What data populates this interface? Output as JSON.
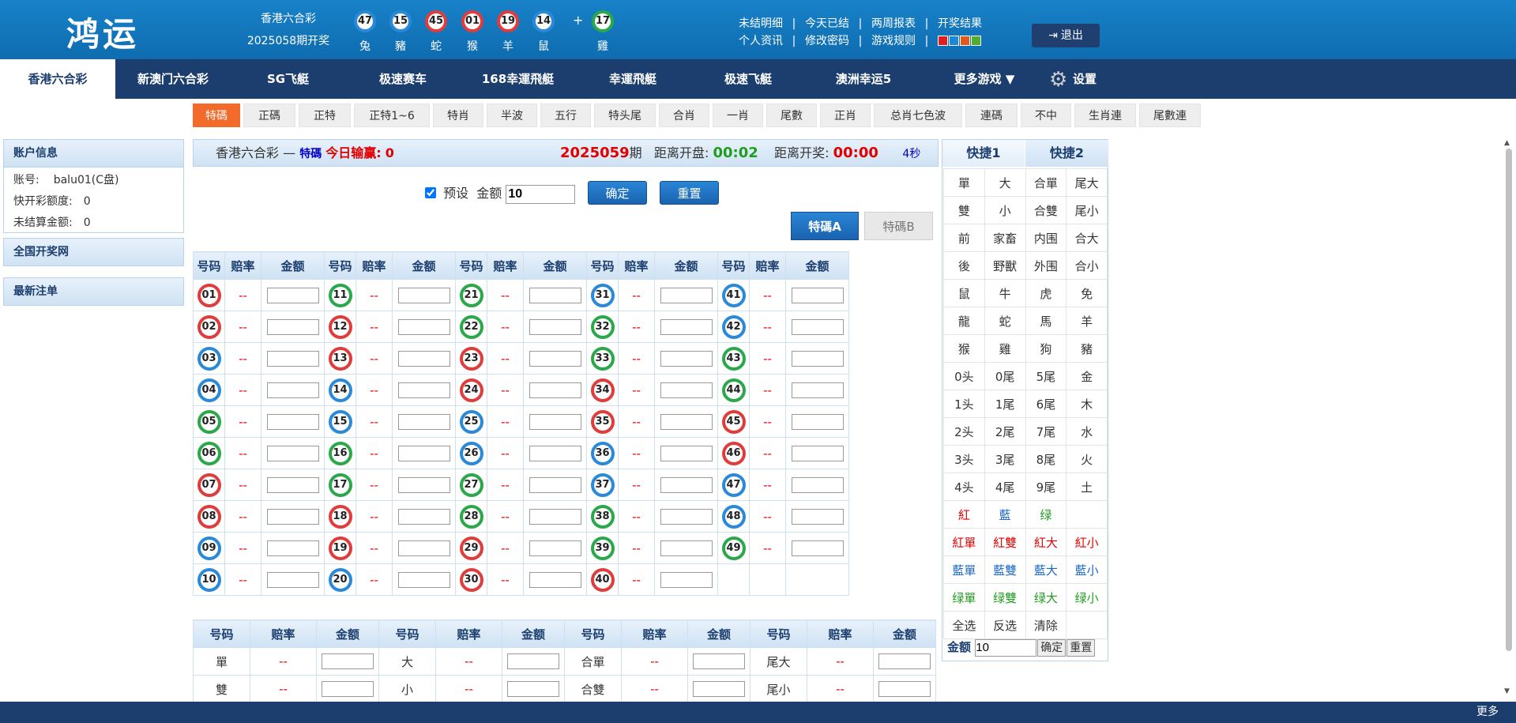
{
  "header": {
    "logo": "鸿运",
    "draw_name": "香港六合彩",
    "draw_issue": "2025058期开奖",
    "balls": [
      {
        "num": "47",
        "zodiac": "兔",
        "color": "blue"
      },
      {
        "num": "15",
        "zodiac": "豬",
        "color": "blue"
      },
      {
        "num": "45",
        "zodiac": "蛇",
        "color": "red"
      },
      {
        "num": "01",
        "zodiac": "猴",
        "color": "red"
      },
      {
        "num": "19",
        "zodiac": "羊",
        "color": "red"
      },
      {
        "num": "14",
        "zodiac": "鼠",
        "color": "blue"
      }
    ],
    "plus": "+",
    "special_ball": {
      "num": "17",
      "zodiac": "雞",
      "color": "green"
    },
    "links_row1": [
      "未结明细",
      "今天已结",
      "两周报表",
      "开奖结果"
    ],
    "links_row2": [
      "个人资讯",
      "修改密码",
      "游戏规则"
    ],
    "separator": "|",
    "swatch_colors": [
      "#e02020",
      "#1a8ad6",
      "#e05a1a",
      "#4fae2a"
    ],
    "logout_label": "退出",
    "logout_icon": "logout-icon"
  },
  "nav": {
    "items": [
      "香港六合彩",
      "新澳门六合彩",
      "SG飞艇",
      "极速赛车",
      "168幸運飛艇",
      "幸運飛艇",
      "极速飞艇",
      "澳洲幸运5",
      "更多游戏 ▼"
    ],
    "active_index": 0,
    "settings_label": "设置",
    "settings_icon": "gear-icon"
  },
  "subtabs": {
    "items": [
      "特碼",
      "正碼",
      "正特",
      "正特1~6",
      "特肖",
      "半波",
      "五行",
      "特头尾",
      "合肖",
      "一肖",
      "尾數",
      "正肖",
      "总肖七色波",
      "連碼",
      "不中",
      "生肖連",
      "尾數連"
    ],
    "active_index": 0
  },
  "sidebar": {
    "account_title": "账户信息",
    "account_rows": [
      {
        "label": "账号:",
        "value": "balu01(C盘)"
      },
      {
        "label": "快开彩额度:",
        "value": "0"
      },
      {
        "label": "未结算金额:",
        "value": "0"
      }
    ],
    "national_title": "全国开奖网",
    "recent_title": "最新注单"
  },
  "bet_header": {
    "game": "香港六合彩",
    "dash": "—",
    "type": "特碼",
    "profit_label": "今日输赢:",
    "profit_value": "0",
    "issue": "2025059",
    "issue_suffix": "期",
    "close_label": "距离开盘:",
    "close_value": "00:02",
    "draw_label": "距离开奖:",
    "draw_value": "00:00",
    "refresh": "4秒"
  },
  "controls": {
    "preset_label": "预设",
    "amount_label": "金额",
    "amount_value": "10",
    "confirm": "确定",
    "reset": "重置",
    "te_a": "特碼A",
    "te_b": "特碼B"
  },
  "num_table": {
    "headers": [
      "号码",
      "赔率",
      "金额"
    ],
    "odds_placeholder": "--",
    "numbers": [
      {
        "n": "01",
        "c": "red"
      },
      {
        "n": "02",
        "c": "red"
      },
      {
        "n": "03",
        "c": "blue"
      },
      {
        "n": "04",
        "c": "blue"
      },
      {
        "n": "05",
        "c": "green"
      },
      {
        "n": "06",
        "c": "green"
      },
      {
        "n": "07",
        "c": "red"
      },
      {
        "n": "08",
        "c": "red"
      },
      {
        "n": "09",
        "c": "blue"
      },
      {
        "n": "10",
        "c": "blue"
      },
      {
        "n": "11",
        "c": "green"
      },
      {
        "n": "12",
        "c": "red"
      },
      {
        "n": "13",
        "c": "red"
      },
      {
        "n": "14",
        "c": "blue"
      },
      {
        "n": "15",
        "c": "blue"
      },
      {
        "n": "16",
        "c": "green"
      },
      {
        "n": "17",
        "c": "green"
      },
      {
        "n": "18",
        "c": "red"
      },
      {
        "n": "19",
        "c": "red"
      },
      {
        "n": "20",
        "c": "blue"
      },
      {
        "n": "21",
        "c": "green"
      },
      {
        "n": "22",
        "c": "green"
      },
      {
        "n": "23",
        "c": "red"
      },
      {
        "n": "24",
        "c": "red"
      },
      {
        "n": "25",
        "c": "blue"
      },
      {
        "n": "26",
        "c": "blue"
      },
      {
        "n": "27",
        "c": "green"
      },
      {
        "n": "28",
        "c": "green"
      },
      {
        "n": "29",
        "c": "red"
      },
      {
        "n": "30",
        "c": "red"
      },
      {
        "n": "31",
        "c": "blue"
      },
      {
        "n": "32",
        "c": "green"
      },
      {
        "n": "33",
        "c": "green"
      },
      {
        "n": "34",
        "c": "red"
      },
      {
        "n": "35",
        "c": "red"
      },
      {
        "n": "36",
        "c": "blue"
      },
      {
        "n": "37",
        "c": "blue"
      },
      {
        "n": "38",
        "c": "green"
      },
      {
        "n": "39",
        "c": "green"
      },
      {
        "n": "40",
        "c": "red"
      },
      {
        "n": "41",
        "c": "blue"
      },
      {
        "n": "42",
        "c": "blue"
      },
      {
        "n": "43",
        "c": "green"
      },
      {
        "n": "44",
        "c": "green"
      },
      {
        "n": "45",
        "c": "red"
      },
      {
        "n": "46",
        "c": "red"
      },
      {
        "n": "47",
        "c": "blue"
      },
      {
        "n": "48",
        "c": "blue"
      },
      {
        "n": "49",
        "c": "green"
      }
    ]
  },
  "prop_table": {
    "headers": [
      "号码",
      "赔率",
      "金额"
    ],
    "rows": [
      [
        "單",
        "大",
        "合單",
        "尾大"
      ],
      [
        "雙",
        "小",
        "合雙",
        "尾小"
      ]
    ]
  },
  "quick": {
    "tabs": [
      "快捷1",
      "快捷2"
    ],
    "active_tab": 0,
    "grid": [
      [
        {
          "t": "單"
        },
        {
          "t": "大"
        },
        {
          "t": "合單"
        },
        {
          "t": "尾大"
        }
      ],
      [
        {
          "t": "雙"
        },
        {
          "t": "小"
        },
        {
          "t": "合雙"
        },
        {
          "t": "尾小"
        }
      ],
      [
        {
          "t": "前"
        },
        {
          "t": "家畜"
        },
        {
          "t": "内围"
        },
        {
          "t": "合大"
        }
      ],
      [
        {
          "t": "後"
        },
        {
          "t": "野獸"
        },
        {
          "t": "外围"
        },
        {
          "t": "合小"
        }
      ],
      [
        {
          "t": "鼠"
        },
        {
          "t": "牛"
        },
        {
          "t": "虎"
        },
        {
          "t": "免"
        }
      ],
      [
        {
          "t": "龍"
        },
        {
          "t": "蛇"
        },
        {
          "t": "馬"
        },
        {
          "t": "羊"
        }
      ],
      [
        {
          "t": "猴"
        },
        {
          "t": "雞"
        },
        {
          "t": "狗"
        },
        {
          "t": "豬"
        }
      ],
      [
        {
          "t": "0头"
        },
        {
          "t": "0尾"
        },
        {
          "t": "5尾"
        },
        {
          "t": "金"
        }
      ],
      [
        {
          "t": "1头"
        },
        {
          "t": "1尾"
        },
        {
          "t": "6尾"
        },
        {
          "t": "木"
        }
      ],
      [
        {
          "t": "2头"
        },
        {
          "t": "2尾"
        },
        {
          "t": "7尾"
        },
        {
          "t": "水"
        }
      ],
      [
        {
          "t": "3头"
        },
        {
          "t": "3尾"
        },
        {
          "t": "8尾"
        },
        {
          "t": "火"
        }
      ],
      [
        {
          "t": "4头"
        },
        {
          "t": "4尾"
        },
        {
          "t": "9尾"
        },
        {
          "t": "土"
        }
      ],
      [
        {
          "t": "紅",
          "c": "red"
        },
        {
          "t": "藍",
          "c": "blue"
        },
        {
          "t": "绿",
          "c": "green"
        },
        {
          "t": ""
        }
      ],
      [
        {
          "t": "紅單",
          "c": "red"
        },
        {
          "t": "紅雙",
          "c": "red"
        },
        {
          "t": "紅大",
          "c": "red"
        },
        {
          "t": "紅小",
          "c": "red"
        }
      ],
      [
        {
          "t": "藍單",
          "c": "blue"
        },
        {
          "t": "藍雙",
          "c": "blue"
        },
        {
          "t": "藍大",
          "c": "blue"
        },
        {
          "t": "藍小",
          "c": "blue"
        }
      ],
      [
        {
          "t": "绿單",
          "c": "green"
        },
        {
          "t": "绿雙",
          "c": "green"
        },
        {
          "t": "绿大",
          "c": "green"
        },
        {
          "t": "绿小",
          "c": "green"
        }
      ],
      [
        {
          "t": "全选"
        },
        {
          "t": "反选"
        },
        {
          "t": "清除"
        },
        {
          "t": ""
        }
      ]
    ],
    "amount_label": "金额",
    "amount_value": "10",
    "confirm": "确定",
    "reset": "重置"
  },
  "footer": {
    "more": "更多"
  }
}
